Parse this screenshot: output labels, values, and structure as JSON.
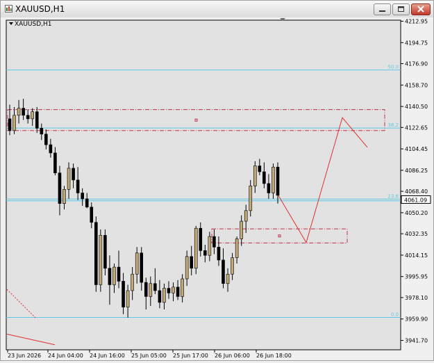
{
  "window": {
    "title": "XAUUSD,H1"
  },
  "chart_data": {
    "type": "candlestick",
    "title": "XAUUSD,H1",
    "symbol": "XAUUSD",
    "timeframe": "H1",
    "ylim": [
      3935.0,
      4217.0
    ],
    "price_ticks": [
      "4212.95",
      "4194.75",
      "4176.90",
      "4158.70",
      "4140.50",
      "4122.65",
      "4104.45",
      "4086.25",
      "4068.40",
      "4050.20",
      "4032.35",
      "4014.15",
      "3995.95",
      "3978.10",
      "3959.90",
      "3941.70"
    ],
    "time_labels": [
      "23 Jun 2026",
      "24 Jun 04:00",
      "24 Jun 16:00",
      "25 Jun 05:00",
      "25 Jun 17:00",
      "26 Jun 06:00",
      "26 Jun 18:00"
    ],
    "current_price": "4061.09",
    "fib_levels": [
      {
        "label": "50.0",
        "price": 4171.5
      },
      {
        "label": "38.2",
        "price": 4122.2
      },
      {
        "label": "23.6",
        "price": 4061.8
      },
      {
        "label": "0.0",
        "price": 3961.2
      }
    ],
    "support_line_price": 4060.3,
    "zones": [
      {
        "from": 4120.0,
        "to": 4137.8
      },
      {
        "from": 4024.5,
        "to": 4036.5
      }
    ],
    "projection": [
      4064.8,
      4024.9,
      4131.0,
      4105.8
    ],
    "candles": [
      [
        4130,
        4142,
        4116,
        4120
      ],
      [
        4120,
        4140,
        4117,
        4133
      ],
      [
        4133,
        4146,
        4126,
        4139
      ],
      [
        4139,
        4147,
        4129,
        4133
      ],
      [
        4133,
        4138,
        4126,
        4130
      ],
      [
        4130,
        4139,
        4124,
        4136
      ],
      [
        4136,
        4140,
        4118,
        4122
      ],
      [
        4122,
        4126,
        4112,
        4117
      ],
      [
        4117,
        4121,
        4104,
        4108
      ],
      [
        4108,
        4113,
        4097,
        4101
      ],
      [
        4101,
        4106,
        4082,
        4084
      ],
      [
        4084,
        4090,
        4048,
        4058
      ],
      [
        4058,
        4073,
        4053,
        4070
      ],
      [
        4070,
        4093,
        4062,
        4088
      ],
      [
        4088,
        4092,
        4071,
        4078
      ],
      [
        4078,
        4089,
        4061,
        4067
      ],
      [
        4067,
        4071,
        4056,
        4062
      ],
      [
        4062,
        4067,
        4054,
        4055
      ],
      [
        4055,
        4059,
        4037,
        4042
      ],
      [
        4042,
        4047,
        3983,
        3989
      ],
      [
        3989,
        4036,
        3983,
        4031
      ],
      [
        4031,
        4036,
        3997,
        4003
      ],
      [
        4003,
        4014,
        3972,
        3989
      ],
      [
        3989,
        4007,
        3982,
        4004
      ],
      [
        4004,
        4018,
        3986,
        3992
      ],
      [
        3992,
        3999,
        3964,
        3970
      ],
      [
        3970,
        3989,
        3961,
        3984
      ],
      [
        3984,
        4004,
        3976,
        3998
      ],
      [
        3998,
        4021,
        3990,
        4016
      ],
      [
        4016,
        4021,
        3984,
        3991
      ],
      [
        3991,
        3995,
        3968,
        3979
      ],
      [
        3979,
        3996,
        3971,
        3990
      ],
      [
        3990,
        4003,
        3981,
        3984
      ],
      [
        3984,
        3993,
        3969,
        3974
      ],
      [
        3974,
        3990,
        3968,
        3986
      ],
      [
        3986,
        3992,
        3977,
        3982
      ],
      [
        3982,
        3991,
        3975,
        3987
      ],
      [
        3987,
        3993,
        3976,
        3979
      ],
      [
        3979,
        3998,
        3974,
        3994
      ],
      [
        3994,
        4018,
        3988,
        4013
      ],
      [
        4013,
        4022,
        3997,
        4003
      ],
      [
        4003,
        4039,
        3998,
        4037
      ],
      [
        4037,
        4042,
        4013,
        4018
      ],
      [
        4018,
        4023,
        4008,
        4014
      ],
      [
        4014,
        4034,
        4009,
        4030
      ],
      [
        4030,
        4036,
        4015,
        4021
      ],
      [
        4021,
        4030,
        4005,
        4010
      ],
      [
        4010,
        4020,
        3986,
        3990
      ],
      [
        3990,
        4003,
        3983,
        3998
      ],
      [
        3998,
        4016,
        3993,
        4012
      ],
      [
        4012,
        4030,
        4007,
        4028
      ],
      [
        4028,
        4048,
        4022,
        4043
      ],
      [
        4043,
        4057,
        4033,
        4052
      ],
      [
        4052,
        4078,
        4047,
        4073
      ],
      [
        4073,
        4094,
        4067,
        4090
      ],
      [
        4090,
        4096,
        4082,
        4085
      ],
      [
        4085,
        4093,
        4071,
        4075
      ],
      [
        4075,
        4083,
        4062,
        4067
      ],
      [
        4067,
        4092,
        4062,
        4089
      ],
      [
        4089,
        4093,
        4058,
        4065
      ]
    ]
  }
}
